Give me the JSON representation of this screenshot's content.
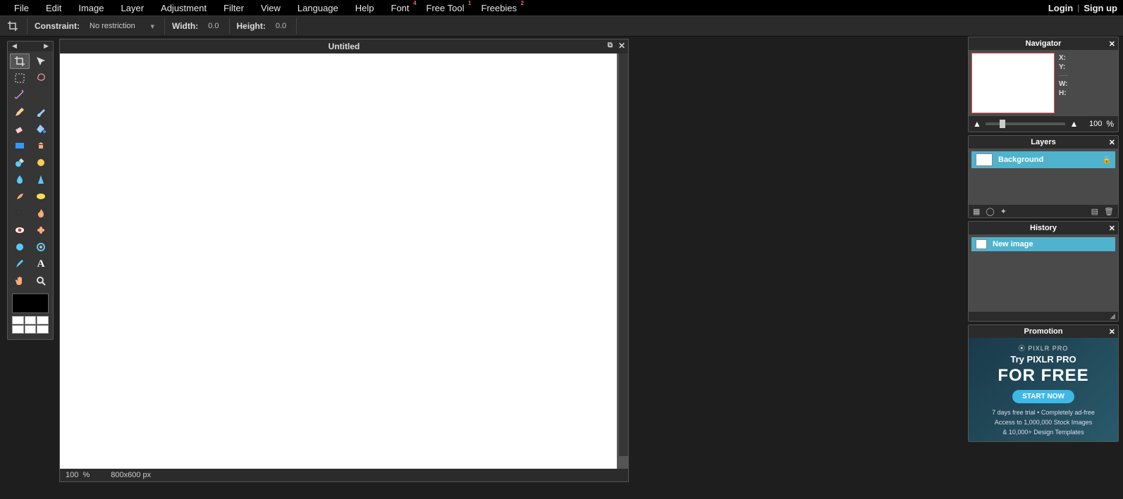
{
  "menu": {
    "items": [
      "File",
      "Edit",
      "Image",
      "Layer",
      "Adjustment",
      "Filter",
      "View",
      "Language",
      "Help",
      "Font",
      "Free Tool",
      "Freebies"
    ],
    "badges": {
      "9": "4",
      "10": "1",
      "11": "2"
    }
  },
  "auth": {
    "login": "Login",
    "signup": "Sign up"
  },
  "options": {
    "constraint_label": "Constraint:",
    "constraint_value": "No restriction",
    "width_label": "Width:",
    "width_value": "0.0",
    "height_label": "Height:",
    "height_value": "0.0"
  },
  "canvas": {
    "title": "Untitled",
    "zoom": "100",
    "zoom_unit": "%",
    "dimensions": "800x600 px"
  },
  "tools": [
    "crop-tool",
    "move-tool",
    "marquee-tool",
    "lasso-tool",
    "wand-tool",
    "",
    "pencil-tool",
    "brush-tool",
    "eraser-tool",
    "paint-bucket-tool",
    "gradient-tool",
    "clone-stamp-tool",
    "color-replace-tool",
    "drawing-tool",
    "blur-tool",
    "sharpen-tool",
    "smudge-tool",
    "sponge-tool",
    "dodge-tool",
    "burn-tool",
    "red-eye-tool",
    "spot-heal-tool",
    "bloat-tool",
    "pinch-tool",
    "colorpicker-tool",
    "type-tool",
    "hand-tool",
    "zoom-tool"
  ],
  "navigator": {
    "title": "Navigator",
    "x_label": "X:",
    "y_label": "Y:",
    "w_label": "W:",
    "h_label": "H:",
    "zoom": "100",
    "zoom_unit": "%"
  },
  "layers": {
    "title": "Layers",
    "items": [
      {
        "name": "Background",
        "locked": true
      }
    ]
  },
  "history": {
    "title": "History",
    "items": [
      {
        "name": "New image"
      }
    ]
  },
  "promotion": {
    "title": "Promotion",
    "logo": "⦿ PIXLR PRO",
    "line1": "Try PIXLR PRO",
    "line2": "FOR FREE",
    "button": "START NOW",
    "detail1": "7 days free trial • Completely ad-free",
    "detail2": "Access to 1,000,000 Stock Images",
    "detail3": "& 10,000+ Design Templates"
  }
}
